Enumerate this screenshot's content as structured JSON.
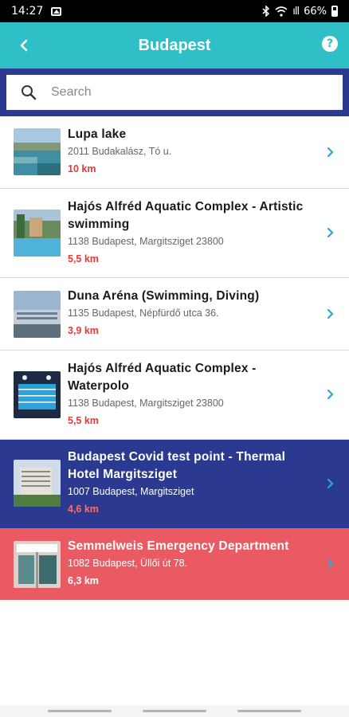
{
  "status_bar": {
    "time": "14:27",
    "battery": "66%",
    "signal": "ıll"
  },
  "header": {
    "title": "Budapest",
    "help": "?",
    "background": "#2fbfc6"
  },
  "search": {
    "placeholder": "Search",
    "value": ""
  },
  "list": {
    "items": [
      {
        "title": "Lupa lake",
        "address": "2011 Budakalász, Tó u.",
        "distance": "10 km"
      },
      {
        "title": "Hajós Alfréd Aquatic Complex - Artistic swimming",
        "address": "1138 Budapest, Margitsziget 23800",
        "distance": "5,5 km"
      },
      {
        "title": "Duna Aréna (Swimming, Diving)",
        "address": "1135 Budapest, Népfürdő utca 36.",
        "distance": "3,9 km"
      },
      {
        "title": "Hajós Alfréd Aquatic Complex - Waterpolo",
        "address": "1138 Budapest, Margitsziget 23800",
        "distance": "5,5 km"
      },
      {
        "title": "Budapest Covid test point - Thermal Hotel Margitsziget",
        "address": "1007 Budapest, Margitsziget",
        "distance": "4,6 km"
      },
      {
        "title": "Semmelweis Emergency Department",
        "address": "1082 Budapest, Üllői út 78.",
        "distance": "6,3 km"
      }
    ]
  },
  "colors": {
    "accent": "#2fbfc6",
    "navy": "#2b3991",
    "emergency": "#ea5a63",
    "distance_red": "#e03a3a"
  },
  "icons": [
    "back-arrow-icon",
    "help-icon",
    "search-icon",
    "chevron-right-icon"
  ]
}
